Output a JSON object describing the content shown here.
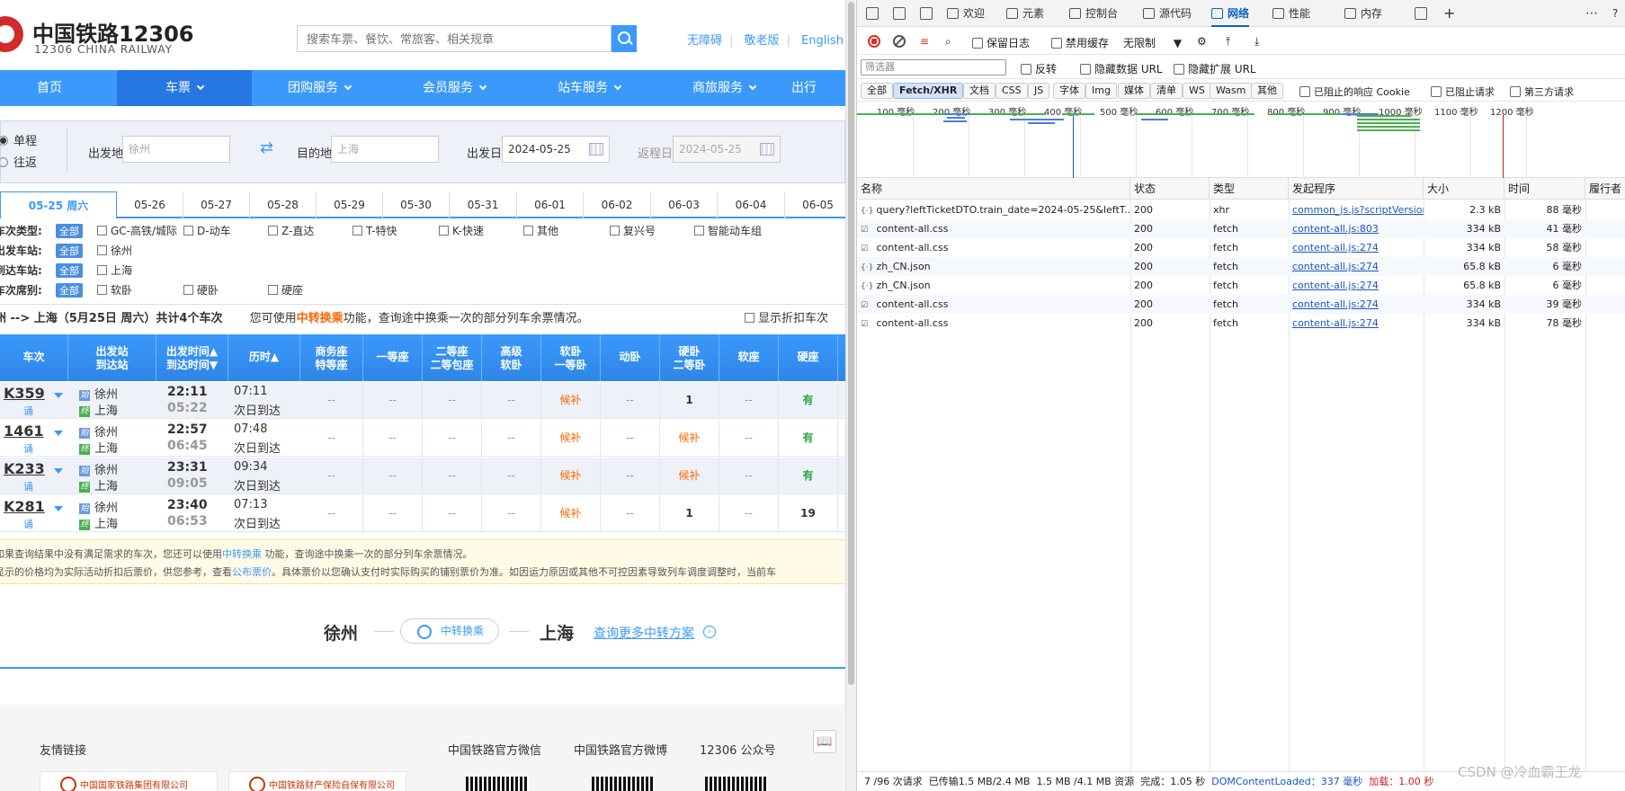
{
  "site": {
    "logo_cn": "中国铁路12306",
    "logo_en": "12306 CHINA RAILWAY",
    "search_placeholder": "搜索车票、餐饮、常旅客、相关规章",
    "top_links": [
      "无障碍",
      "敬老版",
      "English"
    ],
    "nav": [
      "首页",
      "车票",
      "团购服务",
      "会员服务",
      "站车服务",
      "商旅服务",
      "出行"
    ]
  },
  "query": {
    "trip_types": [
      "单程",
      "往返"
    ],
    "from_label": "出发地",
    "from_value": "徐州",
    "to_label": "目的地",
    "to_value": "上海",
    "depart_label": "出发日",
    "depart_value": "2024-05-25",
    "return_label": "返程日",
    "return_value": "2024-05-25"
  },
  "date_tabs": [
    "05-25 周六",
    "05-26",
    "05-27",
    "05-28",
    "05-29",
    "05-30",
    "05-31",
    "06-01",
    "06-02",
    "06-03",
    "06-04",
    "06-05"
  ],
  "filters": {
    "all_label": "全部",
    "train_types": {
      "label": "车次类型:",
      "options": [
        "GC-高铁/城际",
        "D-动车",
        "Z-直达",
        "T-特快",
        "K-快速",
        "其他",
        "复兴号",
        "智能动车组"
      ]
    },
    "from_station": {
      "label": "出发车站:",
      "options": [
        "徐州"
      ]
    },
    "to_station": {
      "label": "到达车站:",
      "options": [
        "上海"
      ]
    },
    "seat_type": {
      "label": "车次席别:",
      "options": [
        "软卧",
        "硬卧",
        "硬座"
      ]
    }
  },
  "summary": {
    "prefix": "州 --> 上海（5月25日  周六）共计4个车次",
    "hint_pre": "您可使用",
    "hint_link": "中转换乘",
    "hint_post": "功能，查询途中换乘一次的部分列车余票情况。",
    "discount": "显示折扣车次"
  },
  "table": {
    "headers": [
      "车次",
      "出发站\n到达站",
      "出发时间▲\n到达时间▼",
      "历时▲",
      "商务座\n特等座",
      "一等座",
      "二等座\n二等包座",
      "高级\n软卧",
      "软卧\n一等卧",
      "动卧",
      "硬卧\n二等卧",
      "软座",
      "硬座"
    ],
    "rows": [
      {
        "no": "K359",
        "badge": "诵",
        "from": "徐州",
        "to": "上海",
        "dep": "22:11",
        "arr": "05:22",
        "dur": "07:11",
        "dur2": "次日到达",
        "seats": [
          "--",
          "--",
          "--",
          "--",
          "候补",
          "--",
          "1",
          "--",
          "有"
        ]
      },
      {
        "no": "1461",
        "badge": "诵",
        "from": "徐州",
        "to": "上海",
        "dep": "22:57",
        "arr": "06:45",
        "dur": "07:48",
        "dur2": "次日到达",
        "seats": [
          "--",
          "--",
          "--",
          "--",
          "候补",
          "--",
          "候补",
          "--",
          "有"
        ]
      },
      {
        "no": "K233",
        "badge": "诵",
        "from": "徐州",
        "to": "上海",
        "dep": "23:31",
        "arr": "09:05",
        "dur": "09:34",
        "dur2": "次日到达",
        "seats": [
          "--",
          "--",
          "--",
          "--",
          "候补",
          "--",
          "候补",
          "--",
          "有"
        ]
      },
      {
        "no": "K281",
        "badge": "诵",
        "from": "徐州",
        "to": "上海",
        "dep": "23:40",
        "arr": "06:53",
        "dur": "07:13",
        "dur2": "次日到达",
        "seats": [
          "--",
          "--",
          "--",
          "--",
          "候补",
          "--",
          "1",
          "--",
          "19"
        ]
      }
    ]
  },
  "notice": {
    "line1_pre": "如果查询结果中没有满足需求的车次，您还可以使用",
    "line1_link": "中转换乘",
    "line1_post": " 功能，查询途中换乘一次的部分列车余票情况。",
    "line2_pre": "显示的价格均为实际活动折扣后票价，供您参考，查看",
    "line2_link": "公布票价",
    "line2_post": "。具体票价以您确认支付时实际购买的铺别票价为准。如因运力原因或其他不可控因素导致列车调度调整时，当前车"
  },
  "transfer": {
    "from": "徐州",
    "button": "中转换乘",
    "to": "上海",
    "more": "查询更多中转方案"
  },
  "footer": {
    "links_title": "友情链接",
    "titles": [
      "中国铁路官方微信",
      "中国铁路官方微博",
      "12306 公众号"
    ],
    "cards": [
      "中国国家铁路集团有限公司",
      "中国铁路财产保险自保有限公司"
    ]
  },
  "devtools": {
    "tabs": [
      "欢迎",
      "元素",
      "控制台",
      "源代码",
      "网络",
      "性能",
      "内存"
    ],
    "toolbar": {
      "preserve_log": "保留日志",
      "disable_cache": "禁用缓存",
      "throttle": "无限制"
    },
    "filter_placeholder": "筛选器",
    "invert": "反转",
    "hide_data_url": "隐藏数据 URL",
    "hide_ext_url": "隐藏扩展 URL",
    "types": [
      "全部",
      "Fetch/XHR",
      "文档",
      "CSS",
      "JS",
      "字体",
      "Img",
      "媒体",
      "清单",
      "WS",
      "Wasm",
      "其他"
    ],
    "blocked_cookies": "已阻止的响应 Cookie",
    "blocked_requests": "已阻止请求",
    "third_party": "第三方请求",
    "timeline_ticks": [
      "100 毫秒",
      "200 毫秒",
      "300 毫秒",
      "400 毫秒",
      "500 毫秒",
      "600 毫秒",
      "700 毫秒",
      "800 毫秒",
      "900 毫秒",
      "1000 毫秒",
      "1100 毫秒",
      "1200 毫秒"
    ],
    "columns": [
      "名称",
      "状态",
      "类型",
      "发起程序",
      "大小",
      "时间",
      "履行者"
    ],
    "requests": [
      {
        "name": "query?leftTicketDTO.train_date=2024-05-25&leftT...",
        "icon": "json",
        "status": "200",
        "type": "xhr",
        "initiator": "common_js.js?scriptVersion",
        "size": "2.3 kB",
        "time": "88 毫秒"
      },
      {
        "name": "content-all.css",
        "icon": "css",
        "status": "200",
        "type": "fetch",
        "initiator": "content-all.js:803",
        "size": "334 kB",
        "time": "41 毫秒"
      },
      {
        "name": "content-all.css",
        "icon": "css",
        "status": "200",
        "type": "fetch",
        "initiator": "content-all.js:274",
        "size": "334 kB",
        "time": "58 毫秒"
      },
      {
        "name": "zh_CN.json",
        "icon": "json",
        "status": "200",
        "type": "fetch",
        "initiator": "content-all.js:274",
        "size": "65.8 kB",
        "time": "6 毫秒"
      },
      {
        "name": "zh_CN.json",
        "icon": "json",
        "status": "200",
        "type": "fetch",
        "initiator": "content-all.js:274",
        "size": "65.8 kB",
        "time": "6 毫秒"
      },
      {
        "name": "content-all.css",
        "icon": "css",
        "status": "200",
        "type": "fetch",
        "initiator": "content-all.js:274",
        "size": "334 kB",
        "time": "39 毫秒"
      },
      {
        "name": "content-all.css",
        "icon": "css",
        "status": "200",
        "type": "fetch",
        "initiator": "content-all.js:274",
        "size": "334 kB",
        "time": "78 毫秒"
      }
    ],
    "status": {
      "requests": "7 /96 次请求",
      "transferred": "已传输1.5 MB/2.4 MB",
      "resources": "1.5 MB /4.1 MB 资源",
      "finish": "完成：1.05 秒",
      "dcl": "DOMContentLoaded：337 毫秒",
      "load": "加载：1.00 秒"
    }
  },
  "watermark": "CSDN @冷血霸王龙",
  "colors": {
    "brand": "#3b99fc",
    "brand_dark": "#2676e3",
    "orange": "#ff6600",
    "green": "#28a745",
    "devtools_link": "#1a56c4"
  }
}
